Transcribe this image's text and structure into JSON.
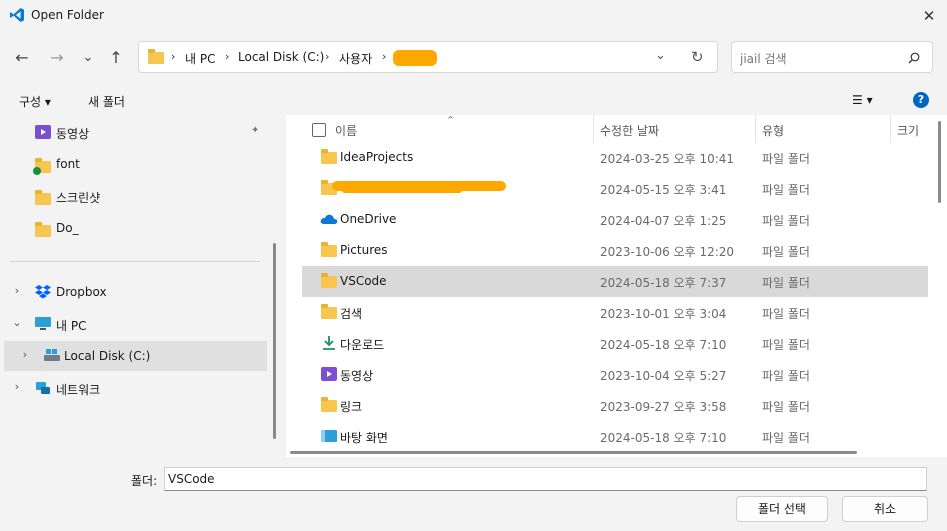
{
  "window": {
    "title": "Open Folder",
    "close_glyph": "✕"
  },
  "nav": {
    "back_glyph": "←",
    "forward_glyph": "→",
    "recent_glyph": "⌄",
    "up_glyph": "↑",
    "breadcrumb": [
      "내 PC",
      "Local Disk (C:)",
      "사용자"
    ],
    "crumb_sep": "›",
    "dropdown_glyph": "⌄",
    "refresh_glyph": "↻"
  },
  "search": {
    "placeholder": "jiail 검색",
    "icon": "search-icon"
  },
  "toolbar": {
    "organize_label": "구성 ▾",
    "new_folder_label": "새 폴더",
    "view_glyph": "☰ ▾",
    "help_glyph": "?"
  },
  "sidebar": {
    "items": [
      {
        "label": "동영상",
        "icon": "video-icon"
      },
      {
        "label": "font",
        "icon": "folder-icon"
      },
      {
        "label": "스크린샷",
        "icon": "folder-icon"
      },
      {
        "label": "Do_",
        "icon": "folder-icon"
      },
      {
        "label": "Dropbox",
        "icon": "dropbox-icon"
      },
      {
        "label": "내 PC",
        "icon": "pc-icon"
      },
      {
        "label": "Local Disk (C:)",
        "icon": "drive-icon"
      },
      {
        "label": "네트워크",
        "icon": "network-icon"
      }
    ],
    "pin_glyph": "📌"
  },
  "list": {
    "headers": {
      "name": "이름",
      "date": "수정한 날짜",
      "type": "유형",
      "size": "크기"
    },
    "sort_glyph": "⌃",
    "rows": [
      {
        "name": "IdeaProjects",
        "date": "2024-03-25 오후 10:41",
        "type": "파일 폴더",
        "icon": "folder-icon"
      },
      {
        "name": "",
        "date": "2024-05-15 오후 3:41",
        "type": "파일 폴더",
        "icon": "folder-icon"
      },
      {
        "name": "OneDrive",
        "date": "2024-04-07 오후 1:25",
        "type": "파일 폴더",
        "icon": "onedrive-icon"
      },
      {
        "name": "Pictures",
        "date": "2023-10-06 오후 12:20",
        "type": "파일 폴더",
        "icon": "folder-icon"
      },
      {
        "name": "VSCode",
        "date": "2024-05-18 오후 7:37",
        "type": "파일 폴더",
        "icon": "folder-icon"
      },
      {
        "name": "검색",
        "date": "2023-10-01 오후 3:04",
        "type": "파일 폴더",
        "icon": "folder-icon"
      },
      {
        "name": "다운로드",
        "date": "2024-05-18 오후 7:10",
        "type": "파일 폴더",
        "icon": "download-icon"
      },
      {
        "name": "동영상",
        "date": "2023-10-04 오후 5:27",
        "type": "파일 폴더",
        "icon": "video-icon"
      },
      {
        "name": "링크",
        "date": "2023-09-27 오후 3:58",
        "type": "파일 폴더",
        "icon": "folder-icon"
      },
      {
        "name": "바탕 화면",
        "date": "2024-05-18 오후 7:10",
        "type": "파일 폴더",
        "icon": "desktop-icon"
      }
    ],
    "selected_index": 4
  },
  "footer": {
    "folder_label": "폴더:",
    "folder_value": "VSCode",
    "select_button": "폴더 선택",
    "cancel_button": "취소"
  },
  "colors": {
    "accent": "#0067c0",
    "folder": "#f7c64e",
    "redaction": "#ffa800",
    "selected": "#d9d9d9"
  }
}
